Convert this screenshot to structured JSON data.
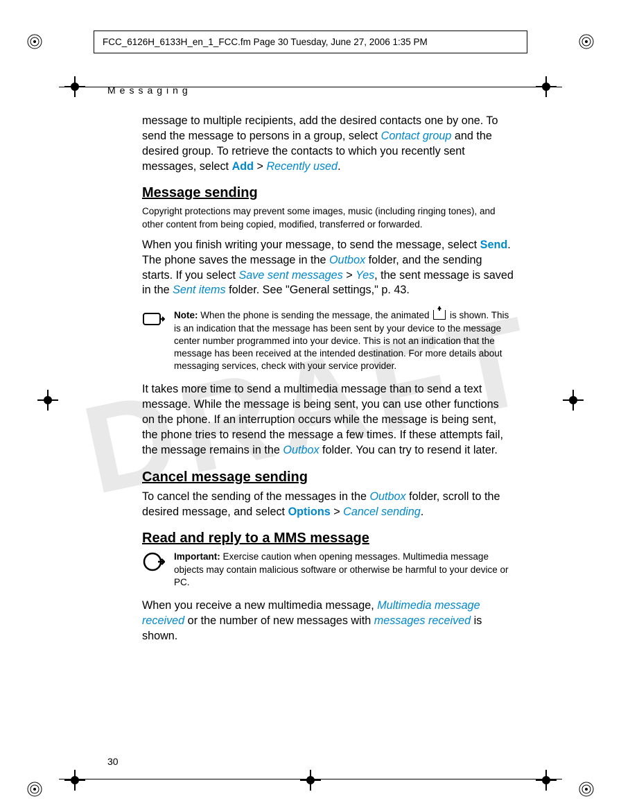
{
  "watermark": "DRAFT",
  "header": {
    "text": "FCC_6126H_6133H_en_1_FCC.fm  Page 30  Tuesday, June 27, 2006  1:35 PM"
  },
  "section_label": "Messaging",
  "intro": {
    "t1": "message to multiple recipients, add the desired contacts one by one. To send the message to persons in a group, select ",
    "link1": "Contact group",
    "t2": " and the desired group. To retrieve the contacts to which you recently sent messages, select ",
    "bold1": "Add",
    "gt": " > ",
    "link2": "Recently used",
    "t3": "."
  },
  "s1": {
    "heading": "Message sending",
    "copyright": "Copyright protections may prevent some images, music (including ringing tones), and other content from being copied, modified, transferred or forwarded.",
    "p1a": "When you finish writing your message, to send the message, select ",
    "p1b": "Send",
    "p1c": ". The phone saves the message in the ",
    "p1d": "Outbox",
    "p1e": " folder, and the sending starts. If you select ",
    "p1f": "Save sent messages",
    "p1g": " > ",
    "p1h": "Yes",
    "p1i": ", the sent message is saved in the ",
    "p1j": "Sent items",
    "p1k": " folder. See \"General settings,\" p. 43.",
    "note_label": "Note: ",
    "note_a": "When the phone is sending the message, the animated ",
    "note_b": " is shown. This is an indication that the message has been sent by your device to the message center number programmed into your device. This is not an indication that the message has been received at the intended destination. For more details about messaging services, check with your service provider.",
    "p2a": "It takes more time to send a multimedia message than to send a text message. While the message is being sent, you can use other functions on the phone. If an interruption occurs while the message is being sent, the phone tries to resend the message a few times. If these attempts fail, the message remains in the ",
    "p2b": "Outbox",
    "p2c": " folder. You can try to resend it later."
  },
  "s2": {
    "heading": "Cancel message sending",
    "p1a": "To cancel the sending of the messages in the ",
    "p1b": "Outbox",
    "p1c": " folder, scroll to the desired message, and select ",
    "p1d": "Options",
    "p1e": " > ",
    "p1f": "Cancel sending",
    "p1g": "."
  },
  "s3": {
    "heading": "Read and reply to a MMS message",
    "important_label": "Important: ",
    "important_text": "Exercise caution when opening messages. Multimedia message objects may contain malicious software or otherwise be harmful to your device or PC.",
    "p1a": "When you receive a new multimedia message, ",
    "p1b": "Multimedia message received",
    "p1c": " or the number of new messages with ",
    "p1d": "messages received",
    "p1e": " is shown."
  },
  "page_number": "30"
}
